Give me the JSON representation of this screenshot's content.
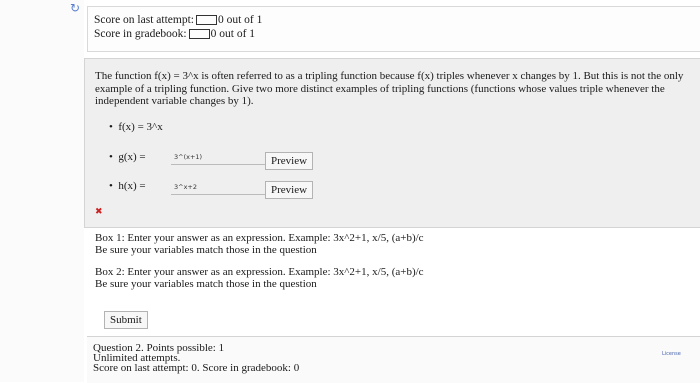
{
  "score": {
    "last_attempt_label": "Score on last attempt:",
    "last_attempt_value": "0 out of 1",
    "gradebook_label": "Score in gradebook:",
    "gradebook_value": "0 out of 1"
  },
  "question1": {
    "statement": "The function f(x) = 3^x is often referred to as a tripling function because f(x) triples whenever x changes by 1. But this is not the only example of a tripling function. Give two more distinct examples of tripling functions (functions whose values triple whenever the independent variable changes by 1).",
    "f_label": "f(x) = 3^x",
    "g_label": "g(x) =",
    "g_value": "3^(x+1)",
    "h_label": "h(x) =",
    "h_value": "3^x+2",
    "preview_label": "Preview",
    "error_mark": "✖"
  },
  "help": {
    "box1_line1": "Box 1: Enter your answer as an expression. Example: 3x^2+1, x/5, (a+b)/c",
    "box1_line2": "Be sure your variables match those in the question",
    "box2_line1": "Box 2: Enter your answer as an expression. Example: 3x^2+1, x/5, (a+b)/c",
    "box2_line2": "Be sure your variables match those in the question"
  },
  "submit_label": "Submit",
  "question2": {
    "line1": "Question 2. Points possible: 1",
    "line2": "Unlimited attempts.",
    "line3": "Score on last attempt: 0. Score in gradebook: 0"
  },
  "license_label": "License"
}
